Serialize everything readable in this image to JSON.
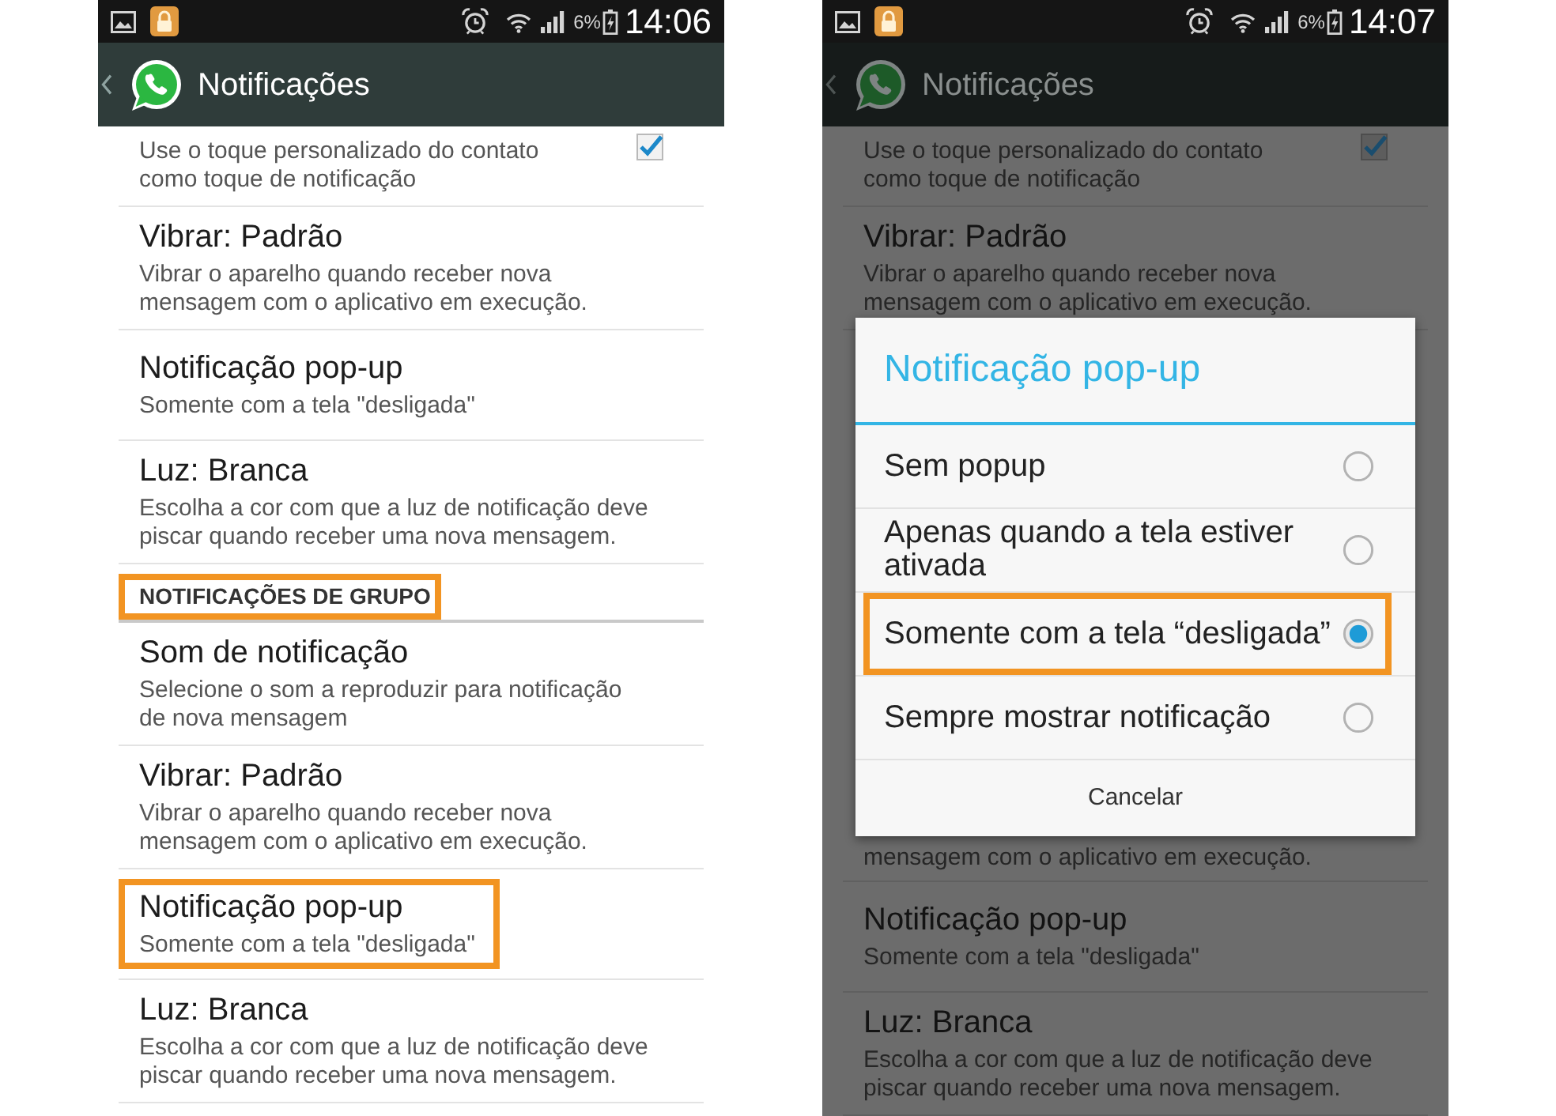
{
  "screens": [
    {
      "status_bar": {
        "battery": "6%",
        "time": "14:06"
      },
      "header": {
        "title": "Notificações"
      },
      "list": [
        {
          "kind": "checkbox",
          "summary": "Use o toque personalizado do contato\ncomo toque de notificação",
          "checked": true,
          "highlighted": false
        },
        {
          "kind": "setting",
          "title": "Vibrar: Padrão",
          "summary": "Vibrar o aparelho quando receber nova\nmensagem com o aplicativo em execução.",
          "highlighted": false
        },
        {
          "kind": "setting",
          "title": "Notificação pop-up",
          "summary": "Somente com a tela \"desligada\"",
          "highlighted": false
        },
        {
          "kind": "setting",
          "title": "Luz: Branca",
          "summary": "Escolha a cor com que a luz de notificação deve\npiscar quando receber uma nova mensagem.",
          "highlighted": false
        },
        {
          "kind": "section",
          "title": "NOTIFICAÇÕES DE GRUPO",
          "highlighted": true
        },
        {
          "kind": "setting",
          "title": "Som de notificação",
          "summary": "Selecione o som a reproduzir para notificação\nde nova mensagem",
          "highlighted": false
        },
        {
          "kind": "setting",
          "title": "Vibrar: Padrão",
          "summary": "Vibrar o aparelho quando receber nova\nmensagem com o aplicativo em execução.",
          "highlighted": false
        },
        {
          "kind": "setting",
          "title": "Notificação pop-up",
          "summary": "Somente com a tela \"desligada\"",
          "highlighted": true
        },
        {
          "kind": "setting",
          "title": "Luz: Branca",
          "summary": "Escolha a cor com que a luz de notificação deve\npiscar quando receber uma nova mensagem.",
          "highlighted": false
        }
      ]
    },
    {
      "status_bar": {
        "battery": "6%",
        "time": "14:07"
      },
      "header": {
        "title": "Notificações"
      },
      "list": [
        {
          "kind": "checkbox",
          "summary": "Use o toque personalizado do contato\ncomo toque de notificação",
          "checked": true,
          "highlighted": false
        },
        {
          "kind": "setting",
          "title": "Vibrar: Padrão",
          "summary": "Vibrar o aparelho quando receber nova\nmensagem com o aplicativo em execução.",
          "highlighted": false
        }
      ],
      "dialog": {
        "title": "Notificação pop-up",
        "options": [
          {
            "label": "Sem popup",
            "selected": false,
            "highlighted": false
          },
          {
            "label": "Apenas quando a tela estiver ativada",
            "selected": false,
            "highlighted": false
          },
          {
            "label": "Somente com a tela “desligada”",
            "selected": true,
            "highlighted": true
          },
          {
            "label": "Sempre mostrar notificação",
            "selected": false,
            "highlighted": false
          }
        ],
        "cancel": "Cancelar"
      },
      "list_below": [
        {
          "kind": "fragment",
          "summary": "mensagem com o aplicativo em execução.",
          "highlighted": false
        },
        {
          "kind": "setting",
          "title": "Notificação pop-up",
          "summary": "Somente com a tela \"desligada\"",
          "highlighted": false
        },
        {
          "kind": "setting",
          "title": "Luz: Branca",
          "summary": "Escolha a cor com que a luz de notificação deve\npiscar quando receber uma nova mensagem.",
          "highlighted": false
        }
      ]
    }
  ]
}
